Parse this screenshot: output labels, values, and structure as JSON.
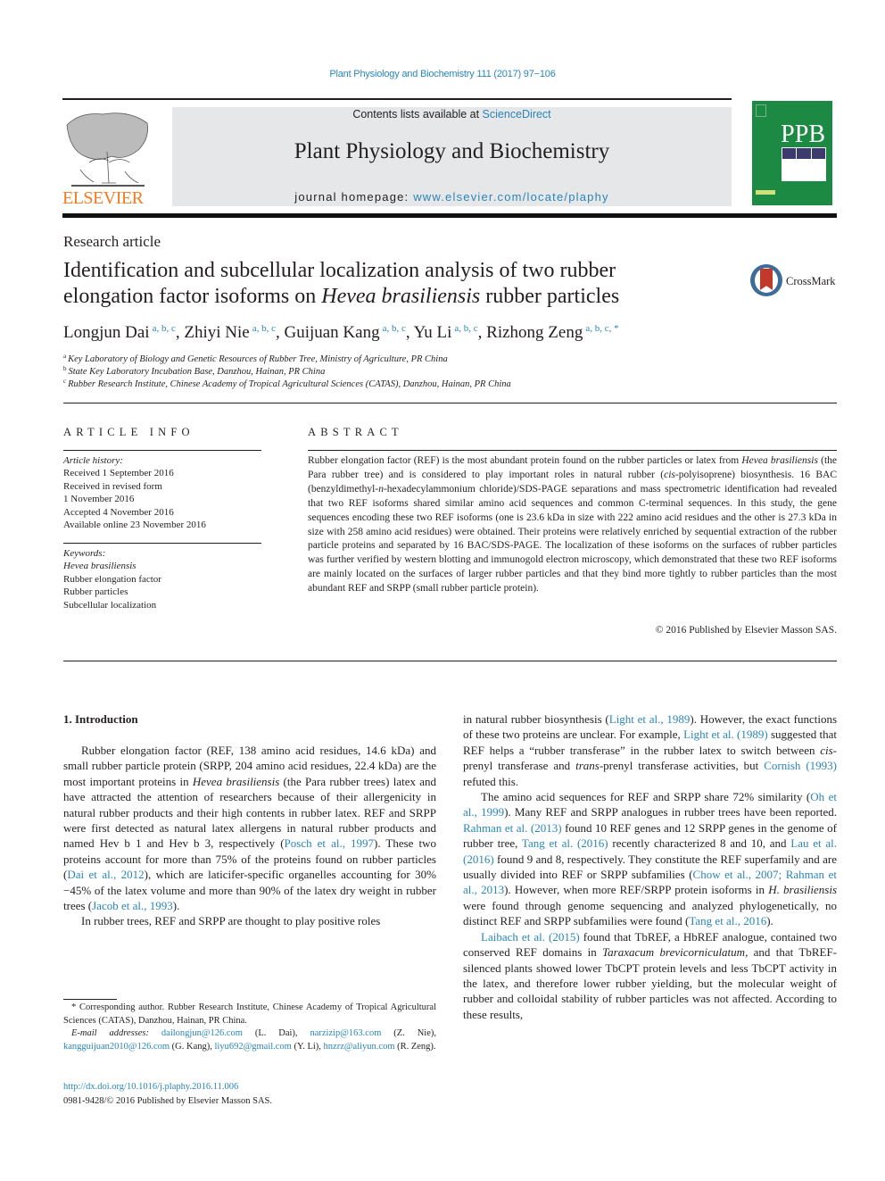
{
  "running_head": "Plant Physiology and Biochemistry 111 (2017) 97−106",
  "masthead": {
    "publisher_logo": "ELSEVIER",
    "contents_prefix": "Contents lists available at ",
    "contents_link": "ScienceDirect",
    "journal_title": "Plant Physiology and Biochemistry",
    "homepage_prefix": "journal homepage: ",
    "homepage_link": "www.elsevier.com/locate/plaphy",
    "cover_abbrev": "PPB"
  },
  "article": {
    "type": "Research article",
    "title_part1": "Identification and subcellular localization analysis of two rubber elongation factor isoforms on ",
    "title_italic": "Hevea brasiliensis",
    "title_part2": " rubber particles",
    "crossmark_label": "CrossMark",
    "authors": [
      {
        "name": "Longjun Dai",
        "affil": "a, b, c",
        "sep": ", "
      },
      {
        "name": "Zhiyi Nie",
        "affil": "a, b, c",
        "sep": ", "
      },
      {
        "name": "Guijuan Kang",
        "affil": "a, b, c",
        "sep": ", "
      },
      {
        "name": "Yu Li",
        "affil": "a, b, c",
        "sep": ", "
      },
      {
        "name": "Rizhong Zeng",
        "affil": "a, b, c, *",
        "sep": ""
      }
    ],
    "affiliations": [
      {
        "key": "a",
        "text": "Key Laboratory of Biology and Genetic Resources of Rubber Tree, Ministry of Agriculture, PR China"
      },
      {
        "key": "b",
        "text": "State Key Laboratory Incubation Base, Danzhou, Hainan, PR China"
      },
      {
        "key": "c",
        "text": "Rubber Research Institute, Chinese Academy of Tropical Agricultural Sciences (CATAS), Danzhou, Hainan, PR China"
      }
    ]
  },
  "article_info": {
    "heading": "ARTICLE INFO",
    "history_label": "Article history:",
    "history": [
      "Received 1 September 2016",
      "Received in revised form",
      "1 November 2016",
      "Accepted 4 November 2016",
      "Available online 23 November 2016"
    ],
    "keywords_label": "Keywords:",
    "keywords": [
      "Hevea brasiliensis",
      "Rubber elongation factor",
      "Rubber particles",
      "Subcellular localization"
    ]
  },
  "abstract": {
    "heading": "ABSTRACT",
    "p1": "Rubber elongation factor (REF) is the most abundant protein found on the rubber particles or latex from ",
    "i1": "Hevea brasiliensis",
    "p2": " (the Para rubber tree) and is considered to play important roles in natural rubber (",
    "i2": "cis",
    "p3": "-polyisoprene) biosynthesis. 16 BAC (benzyldimethyl-",
    "i3": "n",
    "p4": "-hexadecylammonium chloride)/SDS-PAGE separations and mass spectrometric identification had revealed that two REF isoforms shared similar amino acid sequences and common C-terminal sequences. In this study, the gene sequences encoding these two REF isoforms (one is 23.6 kDa in size with 222 amino acid residues and the other is 27.3 kDa in size with 258 amino acid residues) were obtained. Their proteins were relatively enriched by sequential extraction of the rubber particle proteins and separated by 16 BAC/SDS-PAGE. The localization of these isoforms on the surfaces of rubber particles was further verified by western blotting and immunogold electron microscopy, which demonstrated that these two REF isoforms are mainly located on the surfaces of larger rubber particles and that they bind more tightly to rubber particles than the most abundant REF and SRPP (small rubber particle protein).",
    "copyright": "© 2016 Published by Elsevier Masson SAS."
  },
  "intro": {
    "heading": "1.  Introduction",
    "left": {
      "p1a": "Rubber elongation factor (REF, 138 amino acid residues, 14.6 kDa) and small rubber particle protein (SRPP, 204 amino acid residues, 22.4 kDa) are the most important proteins in ",
      "p1i": "Hevea brasiliensis",
      "p1b": " (the Para rubber trees) latex and have attracted the attention of researchers because of their allergenicity in natural rubber products and their high contents in rubber latex. REF and SRPP were first detected as natural latex allergens in natural rubber products and named Hev b 1 and Hev b 3, respectively (",
      "cite1": "Posch et al., 1997",
      "p1c": "). These two proteins account for more than 75% of the proteins found on rubber particles (",
      "cite2": "Dai et al., 2012",
      "p1d": "), which are laticifer-specific organelles accounting for 30%−45% of the latex volume and more than 90% of the latex dry weight in rubber trees (",
      "cite3": "Jacob et al., 1993",
      "p1e": ").",
      "p2": "In rubber trees, REF and SRPP are thought to play positive roles"
    },
    "right": {
      "p1a": "in natural rubber biosynthesis (",
      "cite1": "Light et al., 1989",
      "p1b": "). However, the exact functions of these two proteins are unclear. For example, ",
      "cite2": "Light et al. (1989)",
      "p1c": " suggested that REF helps a “rubber transferase” in the rubber latex to switch between ",
      "i1": "cis",
      "p1d": "-prenyl transferase and ",
      "i2": "trans",
      "p1e": "-prenyl transferase activities, but ",
      "cite3": "Cornish (1993)",
      "p1f": " refuted this.",
      "p2a": "The amino acid sequences for REF and SRPP share 72% similarity (",
      "cite4": "Oh et al., 1999",
      "p2b": "). Many REF and SRPP analogues in rubber trees have been reported. ",
      "cite5": "Rahman et al. (2013)",
      "p2c": " found 10 REF genes and 12 SRPP genes in the genome of rubber tree, ",
      "cite6": "Tang et al. (2016)",
      "p2d": " recently characterized 8 and 10, and ",
      "cite7": "Lau et al. (2016)",
      "p2e": " found 9 and 8, respectively. They constitute the REF superfamily and are usually divided into REF or SRPP subfamilies (",
      "cite8": "Chow et al., 2007; Rahman et al., 2013",
      "p2f": "). However, when more REF/SRPP protein isoforms in ",
      "i3": "H. brasiliensis",
      "p2g": " were found through genome sequencing and analyzed phylogenetically, no distinct REF and SRPP subfamilies were found (",
      "cite9": "Tang et al., 2016",
      "p2h": ").",
      "cite10": "Laibach et al. (2015)",
      "p3a": " found that TbREF, a HbREF analogue, contained two conserved REF domains in ",
      "i4": "Taraxacum brevicorniculatum",
      "p3b": ", and that TbREF-silenced plants showed lower TbCPT protein levels and less TbCPT activity in the latex, and therefore lower rubber yielding, but the molecular weight of rubber and colloidal stability of rubber particles was not affected. According to these results,"
    }
  },
  "footnotes": {
    "corresponding": "* Corresponding author. Rubber Research Institute, Chinese Academy of Tropical Agricultural Sciences (CATAS), Danzhou, Hainan, PR China.",
    "email_label": "E-mail addresses:",
    "emails": [
      {
        "email": "dailongjun@126.com",
        "who": " (L. Dai), "
      },
      {
        "email": "narzizip@163.com",
        "who": " (Z. Nie), "
      },
      {
        "email": "kangguijuan2010@126.com",
        "who": " (G. Kang), "
      },
      {
        "email": "liyu692@gmail.com",
        "who": " (Y. Li), "
      },
      {
        "email": "hnzrz@aliyun.com",
        "who": " (R. Zeng)."
      }
    ],
    "doi": "http://dx.doi.org/10.1016/j.plaphy.2016.11.006",
    "issn": "0981-9428/© 2016 Published by Elsevier Masson SAS."
  }
}
